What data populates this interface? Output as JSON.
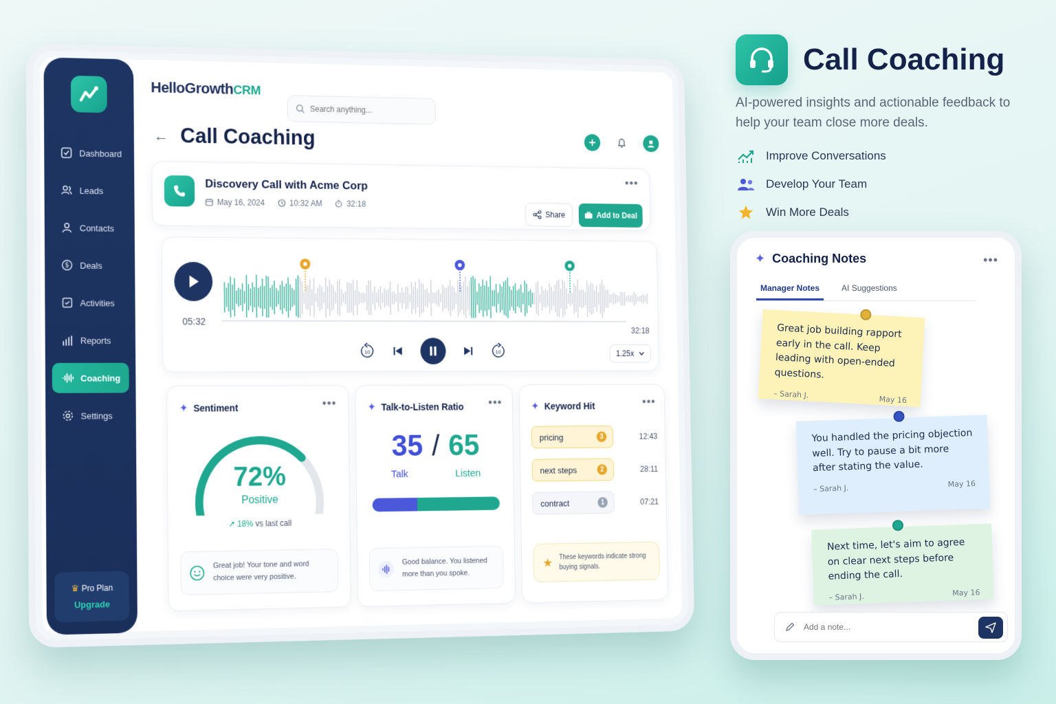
{
  "app": {
    "brand_main": "HelloGrowth",
    "brand_accent": "CRM",
    "search_placeholder": "Search anything...",
    "page_title": "Call Coaching"
  },
  "sidebar": {
    "items": [
      {
        "label": "Dashboard",
        "icon": "checkbox-icon"
      },
      {
        "label": "Leads",
        "icon": "users-icon"
      },
      {
        "label": "Contacts",
        "icon": "user-icon"
      },
      {
        "label": "Deals",
        "icon": "dollar-icon"
      },
      {
        "label": "Activities",
        "icon": "checklist-icon"
      },
      {
        "label": "Reports",
        "icon": "chart-icon"
      },
      {
        "label": "Coaching",
        "icon": "waveform-icon",
        "active": true
      },
      {
        "label": "Settings",
        "icon": "gear-icon"
      }
    ],
    "plan_label": "Pro Plan",
    "upgrade_label": "Upgrade"
  },
  "call": {
    "title": "Discovery Call with Acme Corp",
    "date": "May 16, 2024",
    "time": "10:32 AM",
    "duration": "32:18",
    "share_label": "Share",
    "add_deal_label": "Add to Deal"
  },
  "player": {
    "current_time": "05:32",
    "total_time": "32:18",
    "speed": "1.25x",
    "rewind_label": "10",
    "forward_label": "10",
    "progress": 0.171
  },
  "sentiment": {
    "title": "Sentiment",
    "value": "72%",
    "value_fraction": 0.72,
    "label": "Positive",
    "trend_pct": "18%",
    "trend_text": "vs last call",
    "hint": "Great job! Your tone and word choice were very positive."
  },
  "talk": {
    "title": "Talk-to-Listen Ratio",
    "talk_value": "35",
    "listen_value": "65",
    "slash": "/",
    "talk_label": "Talk",
    "listen_label": "Listen",
    "talk_fraction": 0.35,
    "hint": "Good balance. You listened more than you spoke."
  },
  "keywords": {
    "title": "Keyword Hit",
    "items": [
      {
        "word": "pricing",
        "count": "3",
        "time": "12:43"
      },
      {
        "word": "next steps",
        "count": "2",
        "time": "28:11"
      },
      {
        "word": "contract",
        "count": "1",
        "time": "07:21"
      }
    ],
    "hint": "These keywords indicate strong buying signals."
  },
  "hero": {
    "title": "Call Coaching",
    "subtitle": "AI-powered insights and actionable feedback to help your team close more deals.",
    "features": [
      {
        "label": "Improve Conversations",
        "icon": "trend-up-icon"
      },
      {
        "label": "Develop Your Team",
        "icon": "team-icon"
      },
      {
        "label": "Win More Deals",
        "icon": "star-icon"
      }
    ]
  },
  "notes": {
    "title": "Coaching Notes",
    "tabs": [
      "Manager Notes",
      "AI Suggestions"
    ],
    "items": [
      {
        "text": "Great job building rapport early in the call. Keep leading with open-ended questions.",
        "author": "– Sarah J.",
        "date": "May 16"
      },
      {
        "text": "You handled the pricing objection well. Try to pause a bit more after stating the value.",
        "author": "– Sarah J.",
        "date": "May 16"
      },
      {
        "text": "Next time, let's aim to agree on clear next steps before ending the call.",
        "author": "– Sarah J.",
        "date": "May 16"
      }
    ],
    "input_placeholder": "Add a note..."
  },
  "colors": {
    "teal": "#1fa88f",
    "navy": "#1e3563",
    "indigo": "#4a58d9",
    "amber": "#e8a72c"
  }
}
